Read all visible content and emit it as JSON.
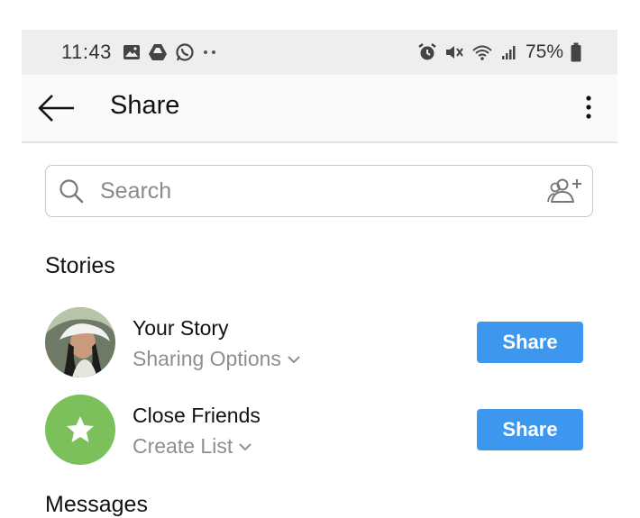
{
  "status_bar": {
    "time": "11:43",
    "battery": "75%",
    "left_icons": [
      "gallery-icon",
      "drive-icon",
      "whatsapp-icon",
      "more-dots-icon"
    ],
    "right_icons": [
      "alarm-icon",
      "mute-icon",
      "wifi-icon",
      "signal-icon",
      "battery-icon"
    ]
  },
  "app_bar": {
    "title": "Share"
  },
  "search": {
    "placeholder": "Search"
  },
  "sections": {
    "stories_title": "Stories",
    "messages_title": "Messages"
  },
  "stories": [
    {
      "name": "Your Story",
      "sub": "Sharing Options",
      "button": "Share"
    },
    {
      "name": "Close Friends",
      "sub": "Create List",
      "button": "Share"
    }
  ],
  "colors": {
    "accent": "#3d97ef",
    "close_friends": "#7cc05c"
  }
}
